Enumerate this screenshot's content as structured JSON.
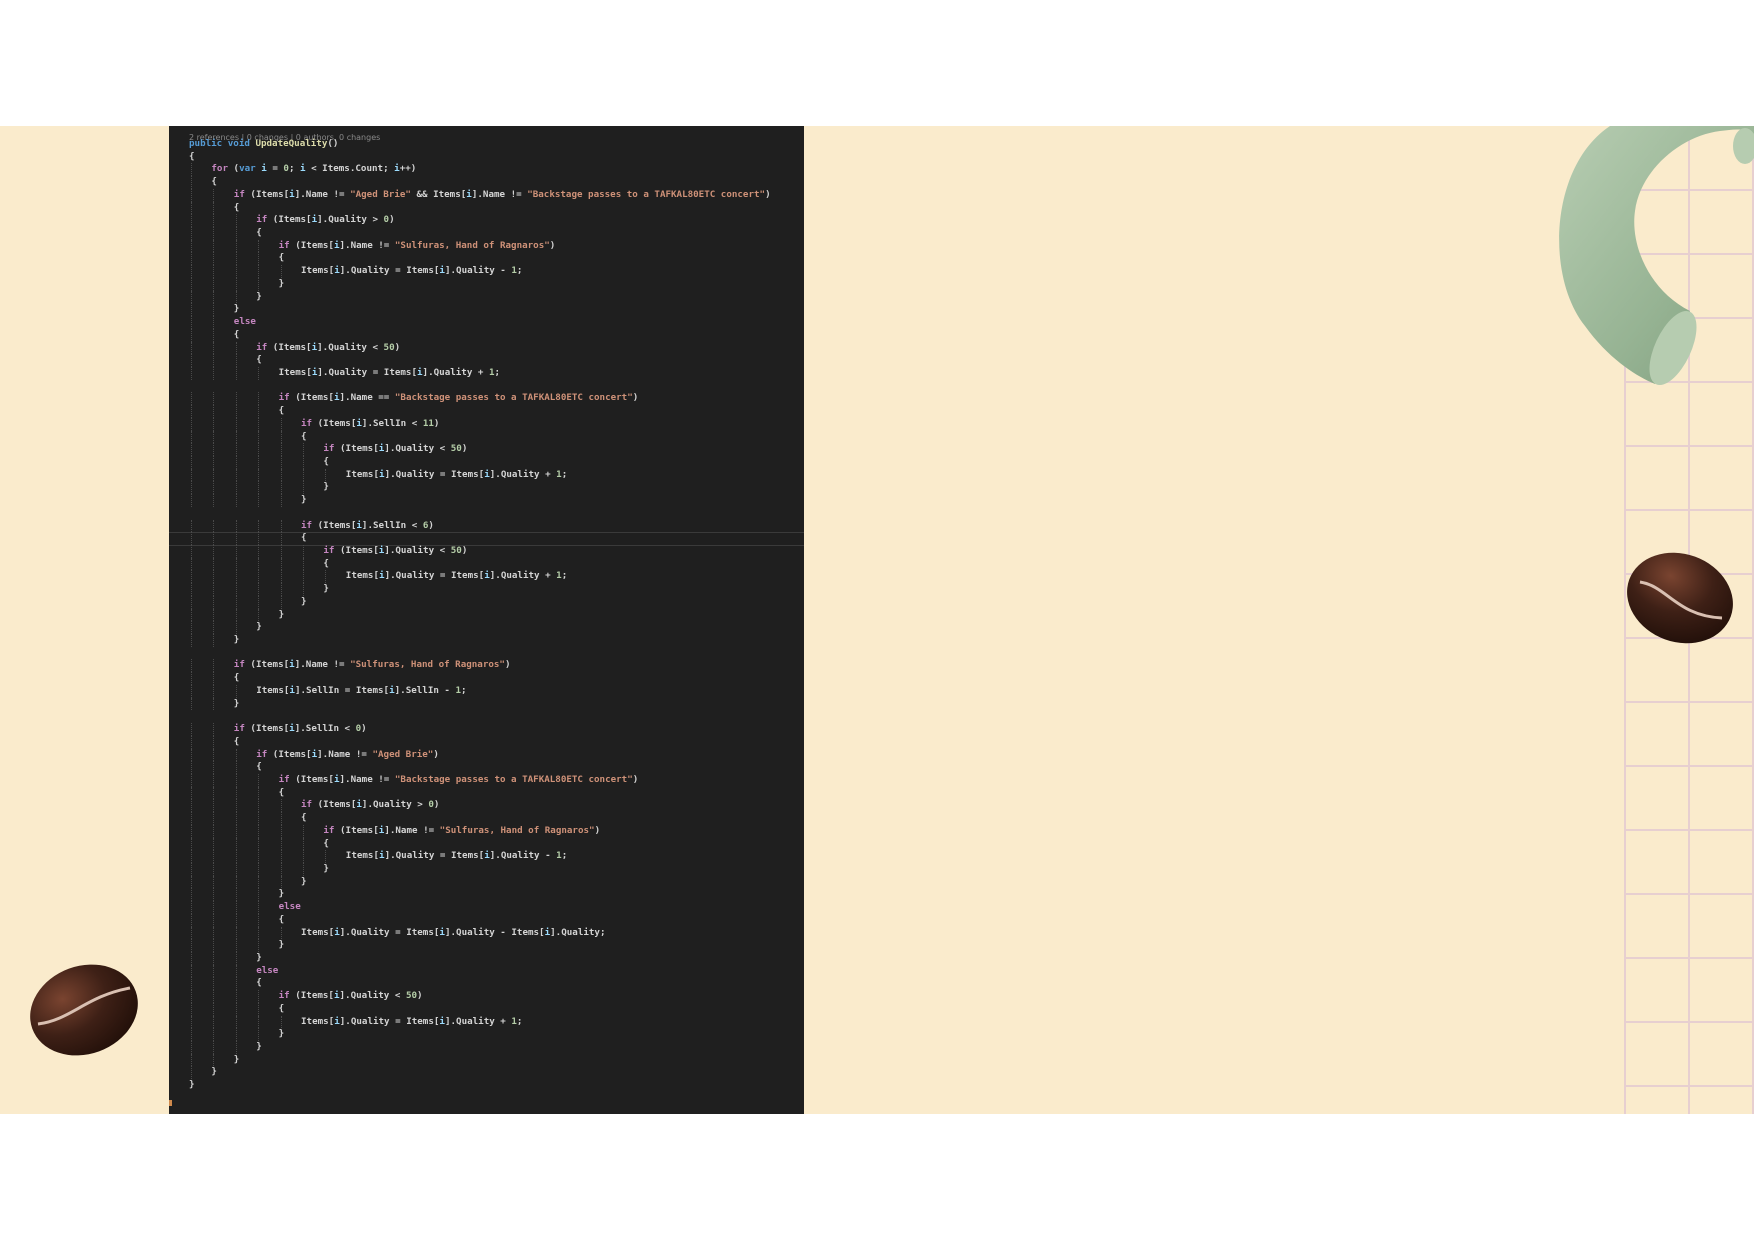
{
  "editor": {
    "codelens": "2 references | 0 changes | 0 authors, 0 changes",
    "language": "C#",
    "current_line": 31,
    "theme": {
      "background": "#1f1f1f",
      "keyword": "#569cd6",
      "control": "#c586c0",
      "function": "#dcdcaa",
      "string": "#ce9178",
      "number": "#b5cea8",
      "variable": "#9cdcfe",
      "text": "#d4d4d4"
    },
    "lines": [
      "public void UpdateQuality()",
      "{",
      "    for (var i = 0; i < Items.Count; i++)",
      "    {",
      "        if (Items[i].Name != \"Aged Brie\" && Items[i].Name != \"Backstage passes to a TAFKAL80ETC concert\")",
      "        {",
      "            if (Items[i].Quality > 0)",
      "            {",
      "                if (Items[i].Name != \"Sulfuras, Hand of Ragnaros\")",
      "                {",
      "                    Items[i].Quality = Items[i].Quality - 1;",
      "                }",
      "            }",
      "        }",
      "        else",
      "        {",
      "            if (Items[i].Quality < 50)",
      "            {",
      "                Items[i].Quality = Items[i].Quality + 1;",
      "",
      "                if (Items[i].Name == \"Backstage passes to a TAFKAL80ETC concert\")",
      "                {",
      "                    if (Items[i].SellIn < 11)",
      "                    {",
      "                        if (Items[i].Quality < 50)",
      "                        {",
      "                            Items[i].Quality = Items[i].Quality + 1;",
      "                        }",
      "                    }",
      "",
      "                    if (Items[i].SellIn < 6)",
      "                    {",
      "                        if (Items[i].Quality < 50)",
      "                        {",
      "                            Items[i].Quality = Items[i].Quality + 1;",
      "                        }",
      "                    }",
      "                }",
      "            }",
      "        }",
      "",
      "        if (Items[i].Name != \"Sulfuras, Hand of Ragnaros\")",
      "        {",
      "            Items[i].SellIn = Items[i].SellIn - 1;",
      "        }",
      "",
      "        if (Items[i].SellIn < 0)",
      "        {",
      "            if (Items[i].Name != \"Aged Brie\")",
      "            {",
      "                if (Items[i].Name != \"Backstage passes to a TAFKAL80ETC concert\")",
      "                {",
      "                    if (Items[i].Quality > 0)",
      "                    {",
      "                        if (Items[i].Name != \"Sulfuras, Hand of Ragnaros\")",
      "                        {",
      "                            Items[i].Quality = Items[i].Quality - 1;",
      "                        }",
      "                    }",
      "                }",
      "                else",
      "                {",
      "                    Items[i].Quality = Items[i].Quality - Items[i].Quality;",
      "                }",
      "            }",
      "            else",
      "            {",
      "                if (Items[i].Quality < 50)",
      "                {",
      "                    Items[i].Quality = Items[i].Quality + 1;",
      "                }",
      "            }",
      "        }",
      "    }",
      "}"
    ]
  },
  "decorations": {
    "colors": {
      "background": "#faebcc",
      "grid": "#e7cfd0",
      "arch": "#9cb79a",
      "bean": "#3a1e14"
    },
    "icons": [
      "green-arch-shape",
      "coffee-bean-icon",
      "grid-pattern"
    ]
  }
}
